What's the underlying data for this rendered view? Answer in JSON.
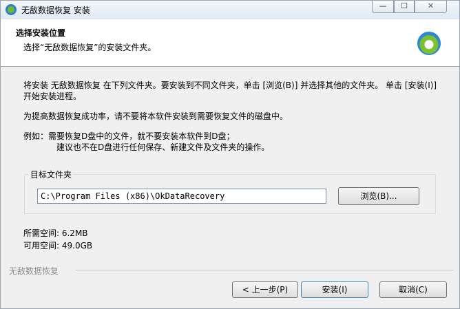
{
  "window": {
    "title": "无敌数据恢复 安装",
    "controls": {
      "minimize": "—",
      "maximize": "☐",
      "close": "✕"
    }
  },
  "header": {
    "title": "选择安装位置",
    "subtitle": "选择“无敌数据恢复”的安装文件夹。"
  },
  "body": {
    "paragraph1": "将安装 无敌数据恢复 在下列文件夹。要安装到不同文件夹，单击 [浏览(B)] 并选择其他的文件夹。 单击 [安装(I)] 开始安装进程。",
    "paragraph2": "为提高数据恢复成功率，请不要将本软件安装到需要恢复文件的磁盘中。",
    "paragraph3_line1": "例如：需要恢复D盘中的文件，就不要安装本软件到D盘；",
    "paragraph3_line2": "建议也不在D盘进行任何保存、新建文件及文件夹的操作。"
  },
  "destination": {
    "group_label": "目标文件夹",
    "path": "C:\\Program Files (x86)\\OkDataRecovery",
    "browse_label": "浏览(B)..."
  },
  "space": {
    "required": "所需空间: 6.2MB",
    "available": "可用空间: 49.0GB"
  },
  "footer": {
    "brand": "无敌数据恢复",
    "back_label": "< 上一步(P)",
    "install_label": "安装(I)",
    "cancel_label": "取消(C)"
  },
  "icons": {
    "app_icon": "app-logo-icon",
    "header_logo": "app-logo-icon"
  },
  "colors": {
    "logo_blue": "#2f86d6",
    "logo_green": "#7cc132"
  }
}
